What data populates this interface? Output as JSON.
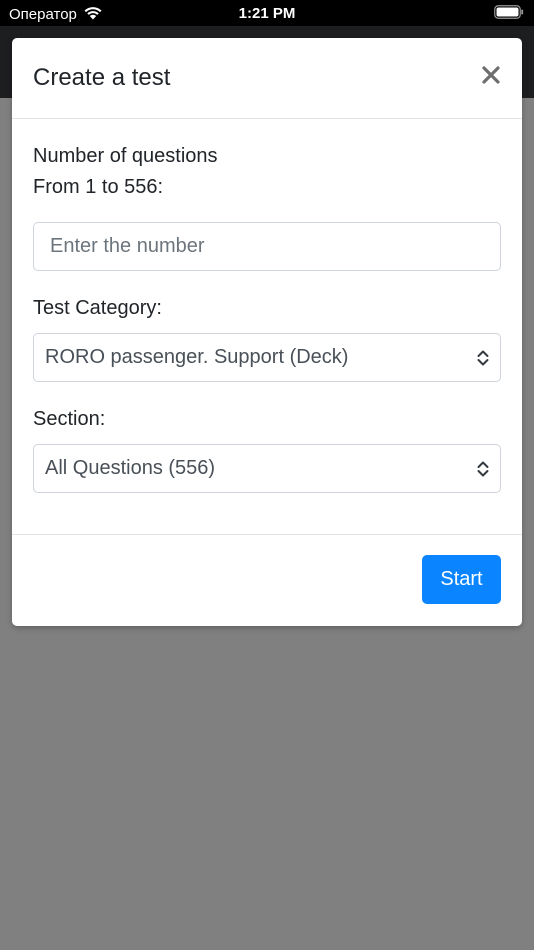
{
  "status_bar": {
    "carrier": "Оператор",
    "time": "1:21 PM"
  },
  "modal": {
    "title": "Create a test",
    "close_icon": "close-icon",
    "number_label_line1": "Number of questions",
    "number_label_line2": "From 1 to 556:",
    "number_input": {
      "value": "",
      "placeholder": "Enter the number"
    },
    "category_label": "Test Category:",
    "category_selected": "RORO passenger. Support (Deck)",
    "section_label": "Section:",
    "section_selected": "All Questions (556)",
    "start_label": "Start"
  },
  "colors": {
    "primary": "#0a84ff",
    "overlay": "#808080"
  }
}
